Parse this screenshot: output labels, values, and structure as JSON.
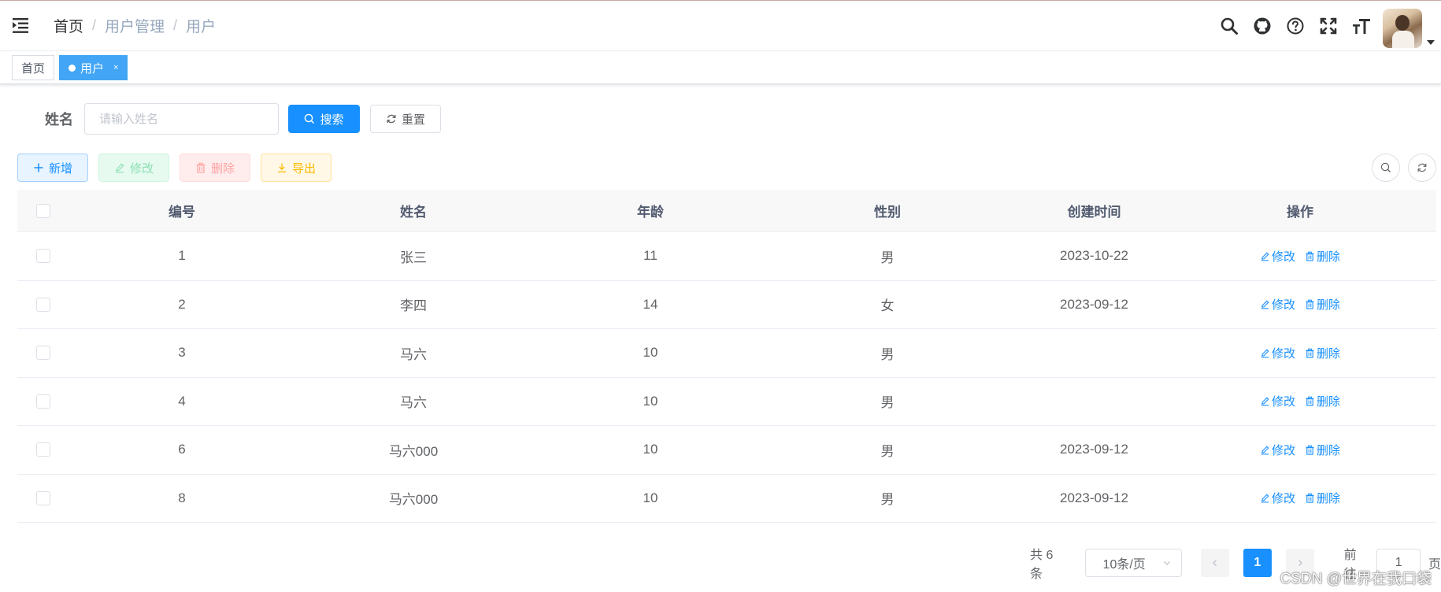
{
  "navbar": {
    "breadcrumb": [
      "首页",
      "用户管理",
      "用户"
    ],
    "breadcrumb_separator": "/",
    "icons": [
      "search-icon",
      "github-icon",
      "question-icon",
      "fullscreen-icon",
      "font-size-icon"
    ]
  },
  "tags": [
    {
      "label": "首页",
      "active": false
    },
    {
      "label": "用户",
      "active": true,
      "close": "×"
    }
  ],
  "search": {
    "label": "姓名",
    "placeholder": "请输入姓名",
    "search_button": "搜索",
    "reset_button": "重置"
  },
  "toolbar": {
    "add": "新增",
    "edit": "修改",
    "delete": "删除",
    "export": "导出"
  },
  "table": {
    "columns": [
      "编号",
      "姓名",
      "年龄",
      "性别",
      "创建时间",
      "操作"
    ],
    "rows": [
      {
        "id": "1",
        "name": "张三",
        "age": "11",
        "sex": "男",
        "time": "2023-10-22"
      },
      {
        "id": "2",
        "name": "李四",
        "age": "14",
        "sex": "女",
        "time": "2023-09-12"
      },
      {
        "id": "3",
        "name": "马六",
        "age": "10",
        "sex": "男",
        "time": ""
      },
      {
        "id": "4",
        "name": "马六",
        "age": "10",
        "sex": "男",
        "time": ""
      },
      {
        "id": "6",
        "name": "马六000",
        "age": "10",
        "sex": "男",
        "time": "2023-09-12"
      },
      {
        "id": "8",
        "name": "马六000",
        "age": "10",
        "sex": "男",
        "time": "2023-09-12"
      }
    ],
    "op_edit": "修改",
    "op_delete": "删除"
  },
  "pagination": {
    "total": "共 6 条",
    "page_size": "10条/页",
    "current_page": "1",
    "goto_label": "前往",
    "goto_value": "1",
    "page_suffix": "页"
  },
  "watermark": "CSDN @世界在我口袋",
  "colors": {
    "primary": "#1890ff",
    "tag_active": "#42a5f5"
  }
}
